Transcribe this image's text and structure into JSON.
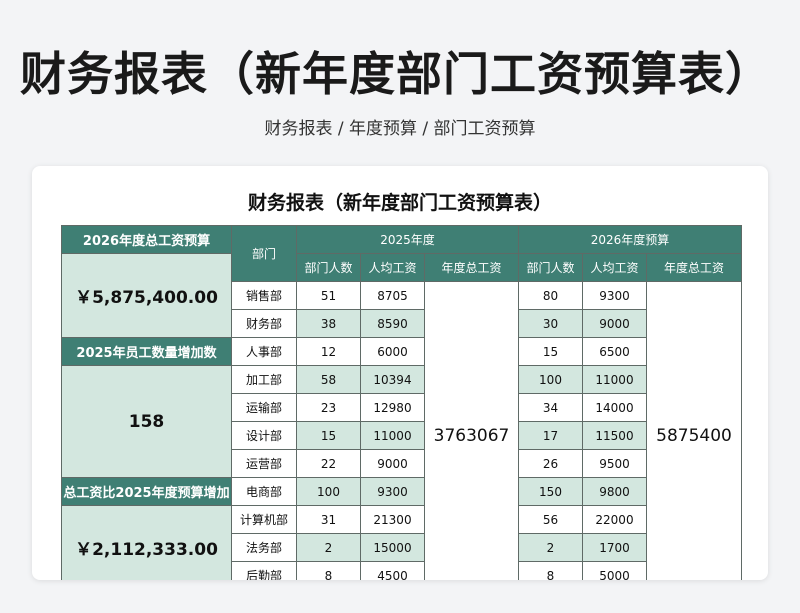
{
  "page_title": "财务报表（新年度部门工资预算表）",
  "breadcrumb": "财务报表 / 年度预算 / 部门工资预算",
  "table_title": "财务报表（新年度部门工资预算表）",
  "side": {
    "total_budget_label": "2026年度总工资预算",
    "total_budget_value": "￥5,875,400.00",
    "staff_increase_label": "2025年员工数量增加数",
    "staff_increase_value": "158",
    "salary_increase_label": "总工资比2025年度预算增加",
    "salary_increase_value": "￥2,112,333.00"
  },
  "headers": {
    "department": "部门",
    "group_2025": "2025年度",
    "group_2026": "2026年度预算",
    "headcount": "部门人数",
    "avg_salary": "人均工资",
    "annual_total": "年度总工资"
  },
  "totals": {
    "total_2025": "3763067",
    "total_2026": "5875400"
  },
  "rows": [
    {
      "dept": "销售部",
      "c2025": "51",
      "s2025": "8705",
      "c2026": "80",
      "s2026": "9300"
    },
    {
      "dept": "财务部",
      "c2025": "38",
      "s2025": "8590",
      "c2026": "30",
      "s2026": "9000"
    },
    {
      "dept": "人事部",
      "c2025": "12",
      "s2025": "6000",
      "c2026": "15",
      "s2026": "6500"
    },
    {
      "dept": "加工部",
      "c2025": "58",
      "s2025": "10394",
      "c2026": "100",
      "s2026": "11000"
    },
    {
      "dept": "运输部",
      "c2025": "23",
      "s2025": "12980",
      "c2026": "34",
      "s2026": "14000"
    },
    {
      "dept": "设计部",
      "c2025": "15",
      "s2025": "11000",
      "c2026": "17",
      "s2026": "11500"
    },
    {
      "dept": "运营部",
      "c2025": "22",
      "s2025": "9000",
      "c2026": "26",
      "s2026": "9500"
    },
    {
      "dept": "电商部",
      "c2025": "100",
      "s2025": "9300",
      "c2026": "150",
      "s2026": "9800"
    },
    {
      "dept": "计算机部",
      "c2025": "31",
      "s2025": "21300",
      "c2026": "56",
      "s2026": "22000"
    },
    {
      "dept": "法务部",
      "c2025": "2",
      "s2025": "15000",
      "c2026": "2",
      "s2026": "1700"
    },
    {
      "dept": "后勤部",
      "c2025": "8",
      "s2025": "4500",
      "c2026": "8",
      "s2026": "5000"
    }
  ]
}
